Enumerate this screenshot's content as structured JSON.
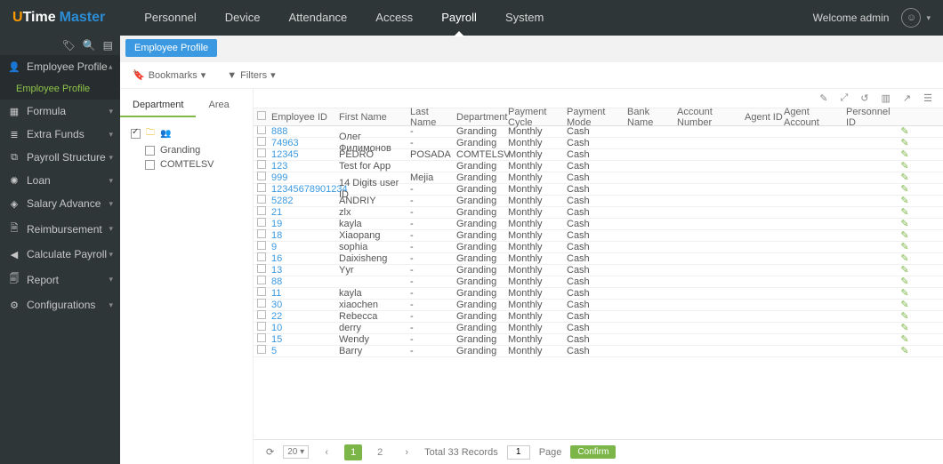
{
  "brand": {
    "u": "U",
    "time": "Time",
    "master": "Master"
  },
  "nav": {
    "items": [
      "Personnel",
      "Device",
      "Attendance",
      "Access",
      "Payroll",
      "System"
    ],
    "active": 4
  },
  "header": {
    "welcome": "Welcome admin",
    "avatarGlyph": "☺",
    "caret": "▾"
  },
  "sidebar": {
    "tools": {
      "tag": "🏷",
      "search": "🔍",
      "collapse": "▤"
    },
    "items": [
      {
        "icon": "👤",
        "label": "Employee Profile",
        "open": true,
        "sub": "Employee Profile"
      },
      {
        "icon": "▦",
        "label": "Formula"
      },
      {
        "icon": "≣",
        "label": "Extra Funds"
      },
      {
        "icon": "⧉",
        "label": "Payroll Structure"
      },
      {
        "icon": "✺",
        "label": "Loan"
      },
      {
        "icon": "◈",
        "label": "Salary Advance"
      },
      {
        "icon": "🗎",
        "label": "Reimbursement"
      },
      {
        "icon": "◀",
        "label": "Calculate Payroll"
      },
      {
        "icon": "🗐",
        "label": "Report"
      },
      {
        "icon": "⚙",
        "label": "Configurations"
      }
    ]
  },
  "tab": {
    "label": "Employee Profile"
  },
  "toolbar": {
    "bookmarkIcon": "🔖",
    "bookmarks": "Bookmarks",
    "filterIcon": "▼",
    "filters": "Filters",
    "caret": "▾"
  },
  "tree": {
    "tabs": [
      "Department",
      "Area"
    ],
    "root": {
      "docIcon": "🗀",
      "orgIcon": "👥"
    },
    "children": [
      {
        "label": "Granding"
      },
      {
        "label": "COMTELSV"
      }
    ]
  },
  "gridtools": {
    "edit": "✎",
    "expand": "⤢",
    "undo": "↺",
    "cols": "▥",
    "export": "↗",
    "settings": "☰"
  },
  "columns": {
    "empid": "Employee ID",
    "fname": "First Name",
    "lname": "Last Name",
    "dept": "Department",
    "cycle": "Payment Cycle",
    "mode": "Payment Mode",
    "bank": "Bank Name",
    "acct": "Account Number",
    "agid": "Agent ID",
    "agacct": "Agent Account",
    "pid": "Personnel ID",
    "editGlyph": "✎"
  },
  "rows": [
    {
      "empid": "888",
      "fname": "",
      "lname": "-",
      "dept": "Granding",
      "cycle": "Monthly",
      "mode": "Cash"
    },
    {
      "empid": "74963",
      "fname": "Олег Филимонов",
      "lname": "-",
      "dept": "Granding",
      "cycle": "Monthly",
      "mode": "Cash"
    },
    {
      "empid": "12345",
      "fname": "PEDRO",
      "lname": "POSADA",
      "dept": "COMTELSV",
      "cycle": "Monthly",
      "mode": "Cash"
    },
    {
      "empid": "123",
      "fname": "Test for App",
      "lname": "",
      "dept": "Granding",
      "cycle": "Monthly",
      "mode": "Cash"
    },
    {
      "empid": "999",
      "fname": "",
      "lname": "Mejia",
      "dept": "Granding",
      "cycle": "Monthly",
      "mode": "Cash"
    },
    {
      "empid": "12345678901234",
      "fname": "14 Digits user ID",
      "lname": "-",
      "dept": "Granding",
      "cycle": "Monthly",
      "mode": "Cash"
    },
    {
      "empid": "5282",
      "fname": "ANDRIY",
      "lname": "-",
      "dept": "Granding",
      "cycle": "Monthly",
      "mode": "Cash"
    },
    {
      "empid": "21",
      "fname": "zlx",
      "lname": "-",
      "dept": "Granding",
      "cycle": "Monthly",
      "mode": "Cash"
    },
    {
      "empid": "19",
      "fname": "kayla",
      "lname": "-",
      "dept": "Granding",
      "cycle": "Monthly",
      "mode": "Cash"
    },
    {
      "empid": "18",
      "fname": "Xiaopang",
      "lname": "-",
      "dept": "Granding",
      "cycle": "Monthly",
      "mode": "Cash"
    },
    {
      "empid": "9",
      "fname": "sophia",
      "lname": "-",
      "dept": "Granding",
      "cycle": "Monthly",
      "mode": "Cash"
    },
    {
      "empid": "16",
      "fname": "Daixisheng",
      "lname": "-",
      "dept": "Granding",
      "cycle": "Monthly",
      "mode": "Cash"
    },
    {
      "empid": "13",
      "fname": "Yyr",
      "lname": "-",
      "dept": "Granding",
      "cycle": "Monthly",
      "mode": "Cash"
    },
    {
      "empid": "88",
      "fname": "",
      "lname": "-",
      "dept": "Granding",
      "cycle": "Monthly",
      "mode": "Cash"
    },
    {
      "empid": "11",
      "fname": "kayla",
      "lname": "-",
      "dept": "Granding",
      "cycle": "Monthly",
      "mode": "Cash"
    },
    {
      "empid": "30",
      "fname": "xiaochen",
      "lname": "-",
      "dept": "Granding",
      "cycle": "Monthly",
      "mode": "Cash"
    },
    {
      "empid": "22",
      "fname": "Rebecca",
      "lname": "-",
      "dept": "Granding",
      "cycle": "Monthly",
      "mode": "Cash"
    },
    {
      "empid": "10",
      "fname": "derry",
      "lname": "-",
      "dept": "Granding",
      "cycle": "Monthly",
      "mode": "Cash"
    },
    {
      "empid": "15",
      "fname": "Wendy",
      "lname": "-",
      "dept": "Granding",
      "cycle": "Monthly",
      "mode": "Cash"
    },
    {
      "empid": "5",
      "fname": "Barry",
      "lname": "-",
      "dept": "Granding",
      "cycle": "Monthly",
      "mode": "Cash"
    }
  ],
  "pager": {
    "refresh": "⟳",
    "pageSize": "20",
    "sizeCaret": "▾",
    "prev": "‹",
    "pages": [
      "1",
      "2"
    ],
    "next": "›",
    "total": "Total 33 Records",
    "gotoValue": "1",
    "pageLabel": "Page",
    "confirm": "Confirm"
  }
}
